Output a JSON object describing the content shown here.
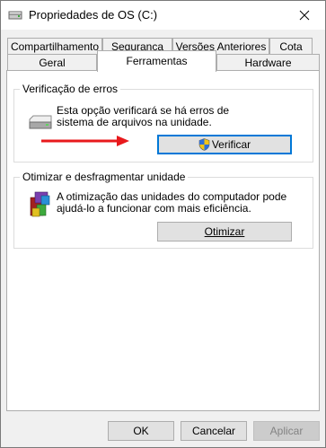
{
  "window": {
    "title": "Propriedades de OS (C:)"
  },
  "tabs_row1": [
    {
      "label": "Compartilhamento"
    },
    {
      "label": "Segurança"
    },
    {
      "label": "Versões Anteriores"
    },
    {
      "label": "Cota"
    }
  ],
  "tabs_row2": [
    {
      "label": "Geral"
    },
    {
      "label": "Ferramentas",
      "active": true
    },
    {
      "label": "Hardware"
    }
  ],
  "error_check": {
    "group_label": "Verificação de erros",
    "description_line1": "Esta opção verificará se há erros de",
    "description_line2": "sistema de arquivos na unidade.",
    "button_label": "Verificar"
  },
  "optimize": {
    "group_label": "Otimizar e desfragmentar unidade",
    "description_line1": "A otimização das unidades do computador pode",
    "description_line2": "ajudá-lo a funcionar com mais eficiência.",
    "button_label": "Otimizar"
  },
  "footer": {
    "ok_label": "OK",
    "cancel_label": "Cancelar",
    "apply_label": "Aplicar"
  },
  "colors": {
    "arrow": "#e8191c",
    "focus_border": "#0078d7"
  }
}
